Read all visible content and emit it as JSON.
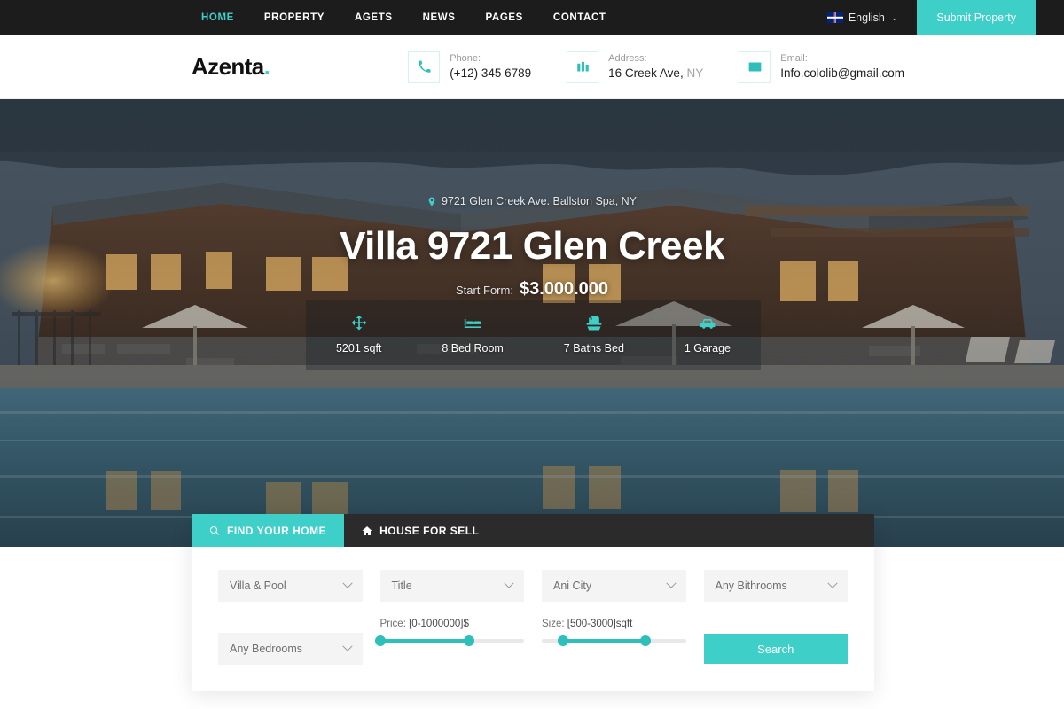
{
  "topbar": {
    "nav": [
      {
        "label": "HOME",
        "active": true
      },
      {
        "label": "PROPERTY",
        "active": false
      },
      {
        "label": "AGETS",
        "active": false
      },
      {
        "label": "NEWS",
        "active": false
      },
      {
        "label": "PAGES",
        "active": false
      },
      {
        "label": "CONTACT",
        "active": false
      }
    ],
    "language": "English",
    "language_icon": "uk-flag-icon",
    "caret": "⌄",
    "submit_label": "Submit Property"
  },
  "header": {
    "logo": "Azenta",
    "logo_dot": ".",
    "contacts": [
      {
        "icon": "phone-icon",
        "label": "Phone:",
        "value": "(+12) 345 6789",
        "suffix": ""
      },
      {
        "icon": "building-icon",
        "label": "Address:",
        "value": "16 Creek Ave,",
        "suffix": "NY"
      },
      {
        "icon": "envelope-icon",
        "label": "Email:",
        "value": "Info.cololib@gmail.com",
        "suffix": ""
      }
    ]
  },
  "hero": {
    "address": "9721 Glen Creek Ave. Ballston Spa, NY",
    "address_icon": "map-pin-icon",
    "title": "Villa 9721 Glen Creek",
    "price_label": "Start Form:",
    "price_value": "$3.000.000",
    "features": [
      {
        "icon": "arrows-move-icon",
        "label": "5201 sqft"
      },
      {
        "icon": "bed-icon",
        "label": "8 Bed Room"
      },
      {
        "icon": "bathtub-icon",
        "label": "7 Baths Bed"
      },
      {
        "icon": "car-icon",
        "label": "1 Garage"
      }
    ]
  },
  "search": {
    "tabs": [
      {
        "label": "FIND YOUR HOME",
        "icon": "search-icon",
        "active": true
      },
      {
        "label": "HOUSE FOR SELL",
        "icon": "home-icon",
        "active": false
      }
    ],
    "selects": [
      {
        "value": "Villa & Pool"
      },
      {
        "value": "Title"
      },
      {
        "value": "Ani City"
      },
      {
        "value": "Any Bithrooms"
      },
      {
        "value": "Any Bedrooms"
      }
    ],
    "price_slider": {
      "label_prefix": "Price:",
      "label_range": "[0-1000000]$",
      "min_pct": 0,
      "max_pct": 62
    },
    "size_slider": {
      "label_prefix": "Size:",
      "label_range": "[500-3000]sqft",
      "min_pct": 15,
      "max_pct": 72
    },
    "search_button": "Search"
  },
  "colors": {
    "accent": "#3ecfc9",
    "accent_dark": "#2fbfba",
    "topbar_bg": "#1c1c1c",
    "tabs_bg": "#2b2b2b",
    "field_bg": "#f4f4f4"
  }
}
